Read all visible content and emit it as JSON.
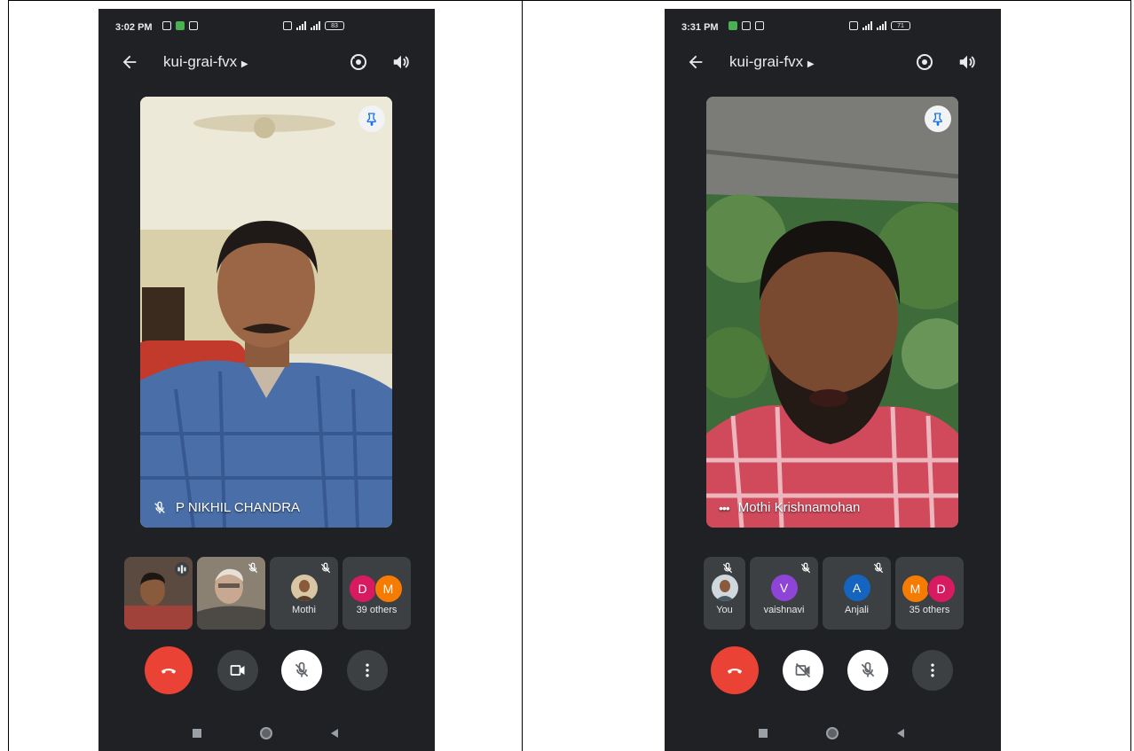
{
  "phones": [
    {
      "status": {
        "time": "3:02 PM",
        "battery": "83"
      },
      "meeting_code": "kui-grai-fvx",
      "main_participant": "P NIKHIL CHANDRA",
      "tiles": [
        {
          "type": "video",
          "label": ""
        },
        {
          "type": "video",
          "label": ""
        },
        {
          "type": "avatar",
          "label": "Mothi",
          "initial": "",
          "muted": true
        },
        {
          "type": "others",
          "label": "39 others",
          "initials": [
            "D",
            "M"
          ]
        }
      ],
      "controls": {
        "camera_on": true,
        "mic_muted": true
      }
    },
    {
      "status": {
        "time": "3:31 PM",
        "battery": "71"
      },
      "meeting_code": "kui-grai-fvx",
      "main_participant": "Mothi Krishnamohan",
      "tiles": [
        {
          "type": "avatar",
          "label": "You",
          "muted": true
        },
        {
          "type": "avatar",
          "label": "vaishnavi",
          "initial": "V",
          "muted": true
        },
        {
          "type": "avatar",
          "label": "Anjali",
          "initial": "A",
          "muted": true
        },
        {
          "type": "others",
          "label": "35 others",
          "initials": [
            "M",
            "D"
          ]
        }
      ],
      "controls": {
        "camera_on": false,
        "mic_muted": true
      }
    }
  ],
  "colors": {
    "background": "#202124",
    "tile": "#3c4043",
    "end_call": "#ea4335",
    "pin_accent": "#1a73e8",
    "avatar_d": "#d81b60",
    "avatar_m": "#f57c00",
    "avatar_v": "#8e44d6",
    "avatar_a": "#1565c0"
  }
}
